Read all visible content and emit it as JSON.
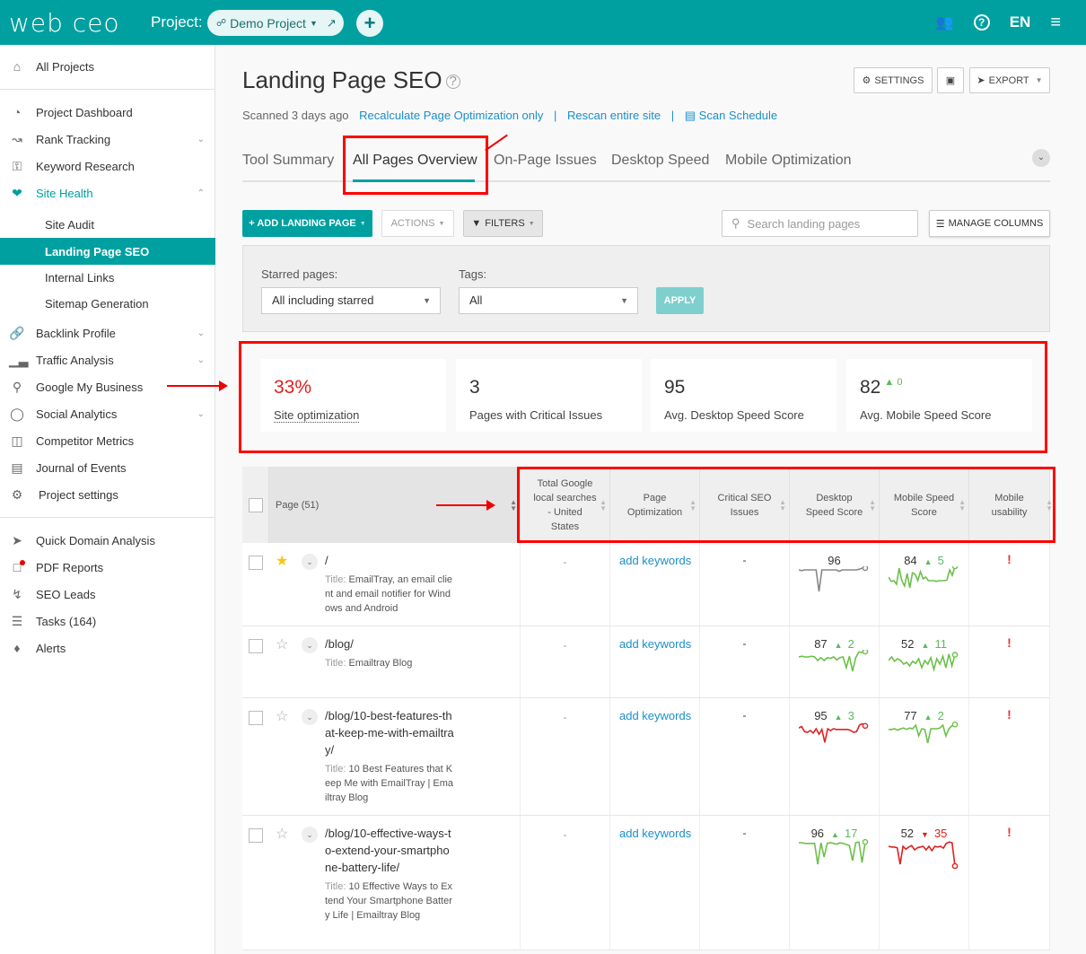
{
  "topbar": {
    "logo": "web ceo",
    "project_label": "Project:",
    "project_name": "Demo Project",
    "lang": "EN",
    "icons": [
      "share-icon",
      "caret-down-icon",
      "external-link-icon",
      "plus-icon",
      "users-icon",
      "help-icon",
      "menu-icon"
    ]
  },
  "sidebar": {
    "all_projects": "All Projects",
    "items": [
      {
        "label": "Project Dashboard",
        "icon": "dashboard-icon"
      },
      {
        "label": "Rank Tracking",
        "icon": "chart-icon",
        "expandable": true
      },
      {
        "label": "Keyword Research",
        "icon": "key-icon"
      },
      {
        "label": "Site Health",
        "icon": "heartbeat-icon",
        "expanded": true,
        "active": true
      },
      {
        "label": "Backlink Profile",
        "icon": "link-icon",
        "expandable": true
      },
      {
        "label": "Traffic Analysis",
        "icon": "bars-icon",
        "expandable": true
      },
      {
        "label": "Google My Business",
        "icon": "map-pin-icon"
      },
      {
        "label": "Social Analytics",
        "icon": "chat-icon",
        "expandable": true
      },
      {
        "label": "Competitor Metrics",
        "icon": "binoculars-icon"
      },
      {
        "label": "Journal of Events",
        "icon": "calendar-icon"
      },
      {
        "label": "Project settings",
        "icon": "gear-icon"
      }
    ],
    "sub_items": [
      "Site Audit",
      "Landing Page SEO",
      "Internal Links",
      "Sitemap Generation"
    ],
    "active_sub": "Landing Page SEO",
    "tools": [
      {
        "label": "Quick Domain Analysis",
        "icon": "rocket-icon"
      },
      {
        "label": "PDF Reports",
        "icon": "pdf-icon",
        "notification": true
      },
      {
        "label": "SEO Leads",
        "icon": "bolt-icon"
      },
      {
        "label": "Tasks (164)",
        "icon": "tasks-icon"
      },
      {
        "label": "Alerts",
        "icon": "bell-icon"
      }
    ]
  },
  "header": {
    "title": "Landing Page SEO",
    "scanned": "Scanned 3 days ago",
    "links": [
      "Recalculate Page Optimization only",
      "Rescan entire site",
      "Scan Schedule"
    ],
    "settings_label": "SETTINGS",
    "export_label": "EXPORT"
  },
  "tabs": [
    "Tool Summary",
    "All Pages Overview",
    "On-Page Issues",
    "Desktop Speed",
    "Mobile Optimization"
  ],
  "active_tab": "All Pages Overview",
  "toolbar": {
    "add_label": "+ ADD LANDING PAGE",
    "actions_label": "ACTIONS",
    "filters_label": "FILTERS",
    "search_placeholder": "Search landing pages",
    "manage_columns_label": "MANAGE COLUMNS"
  },
  "filters": {
    "starred_label": "Starred pages:",
    "starred_value": "All including starred",
    "tags_label": "Tags:",
    "tags_value": "All",
    "apply_label": "APPLY"
  },
  "stats": [
    {
      "value": "33%",
      "label": "Site optimization",
      "color": "#e02020"
    },
    {
      "value": "3",
      "label": "Pages with Critical Issues"
    },
    {
      "value": "95",
      "label": "Avg. Desktop Speed Score"
    },
    {
      "value": "82",
      "label": "Avg. Mobile Speed Score",
      "delta": "0",
      "delta_dir": "up"
    }
  ],
  "table": {
    "columns": [
      "Page (51)",
      "Total Google local searches - United States",
      "Page Optimization",
      "Critical SEO Issues",
      "Desktop Speed Score",
      "Mobile Speed Score",
      "Mobile usability"
    ],
    "rows": [
      {
        "url": "/",
        "title": "EmailTray, an email client and email notifier for Windows and Android",
        "starred": true,
        "searches": "-",
        "optimization": "add keywords",
        "critical": "-",
        "desktop": {
          "score": "96",
          "delta": "",
          "dir": "",
          "color": "#888888",
          "trend": [
            70,
            68,
            70,
            70,
            70,
            70,
            70,
            10,
            70,
            70,
            70,
            70,
            70,
            70,
            66,
            70,
            70,
            70,
            70,
            70,
            70,
            72,
            75,
            75
          ]
        },
        "mobile": {
          "score": "84",
          "delta": "5",
          "dir": "up",
          "color": "#6cc04a",
          "trend": [
            50,
            38,
            40,
            30,
            75,
            40,
            25,
            60,
            20,
            62,
            58,
            40,
            65,
            45,
            50,
            40,
            40,
            40,
            38,
            40,
            40,
            40,
            42,
            70,
            55,
            80
          ]
        },
        "usability": "!"
      },
      {
        "url": "/blog/",
        "title": "Emailtray Blog",
        "starred": false,
        "searches": "-",
        "optimization": "add keywords",
        "critical": "-",
        "desktop": {
          "score": "87",
          "delta": "2",
          "dir": "up",
          "color": "#6cc04a",
          "trend": [
            60,
            62,
            60,
            60,
            62,
            60,
            50,
            58,
            50,
            58,
            56,
            60,
            52,
            58,
            60,
            30,
            62,
            20,
            58,
            74,
            72,
            75
          ]
        },
        "mobile": {
          "score": "52",
          "delta": "11",
          "dir": "up",
          "color": "#6cc04a",
          "trend": [
            50,
            60,
            48,
            55,
            50,
            40,
            45,
            35,
            48,
            42,
            55,
            30,
            50,
            40,
            58,
            25,
            55,
            40,
            62,
            30,
            68,
            35,
            66
          ]
        },
        "usability": "!"
      },
      {
        "url": "/blog/10-best-features-that-keep-me-with-emailtray/",
        "title": "10 Best Features that Keep Me with EmailTray | Emailtray Blog",
        "starred": false,
        "searches": "-",
        "optimization": "add keywords",
        "critical": "-",
        "desktop": {
          "score": "95",
          "delta": "3",
          "dir": "up",
          "color": "#e02020",
          "trend": [
            62,
            66,
            52,
            50,
            55,
            48,
            60,
            45,
            58,
            22,
            60,
            55,
            60,
            58,
            58,
            58,
            58,
            58,
            55,
            50,
            52,
            70,
            74,
            68
          ]
        },
        "mobile": {
          "score": "77",
          "delta": "2",
          "dir": "up",
          "color": "#6cc04a",
          "trend": [
            58,
            58,
            60,
            56,
            60,
            62,
            58,
            62,
            60,
            70,
            40,
            60,
            58,
            20,
            60,
            60,
            60,
            62,
            70,
            40,
            60,
            68,
            72
          ]
        },
        "usability": "!"
      },
      {
        "url": "/blog/10-effective-ways-to-extend-your-smartphone-battery-life/",
        "title": "10 Effective Ways to Extend Your Smartphone Battery Life | Emailtray Blog",
        "starred": false,
        "searches": "-",
        "optimization": "add keywords",
        "critical": "-",
        "desktop": {
          "score": "96",
          "delta": "17",
          "dir": "up",
          "color": "#6cc04a",
          "trend": [
            70,
            70,
            68,
            68,
            68,
            68,
            10,
            70,
            30,
            68,
            70,
            68,
            66,
            70,
            68,
            65,
            62,
            20,
            70,
            72,
            15,
            72
          ]
        },
        "mobile": {
          "score": "52",
          "delta": "35",
          "dir": "down",
          "color": "#e02020",
          "trend": [
            60,
            58,
            58,
            56,
            10,
            60,
            52,
            58,
            62,
            50,
            56,
            58,
            60,
            50,
            60,
            48,
            60,
            58,
            60,
            55,
            68,
            72,
            70,
            5
          ]
        },
        "usability": "!"
      }
    ]
  }
}
